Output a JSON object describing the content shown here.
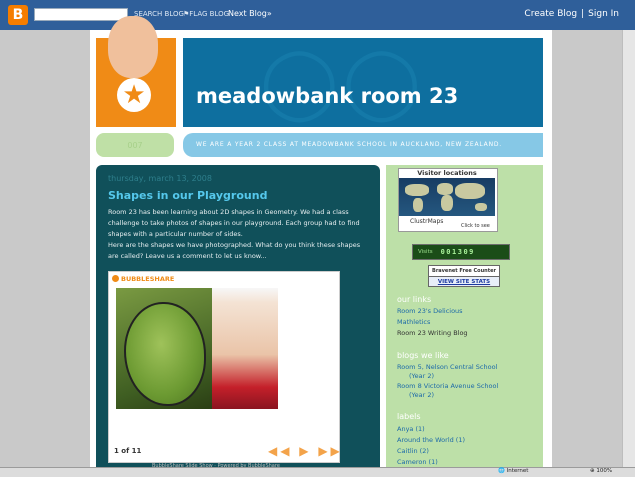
{
  "navbar": {
    "logo_letter": "B",
    "search_link": "SEARCH BLOG",
    "flag_link": "FLAG BLOG",
    "next_blog": "Next Blog»",
    "create_blog": "Create Blog",
    "separator": "|",
    "sign_in": "Sign In"
  },
  "header": {
    "title": "meadowbank room 23",
    "tagline": "WE ARE A YEAR 2 CLASS AT MEADOWBANK SCHOOL IN AUCKLAND, NEW ZEALAND.",
    "left_tab": "007",
    "star": "★"
  },
  "post": {
    "date": "thursday, march 13, 2008",
    "title": "Shapes in our Playground",
    "paragraph1": "Room 23 has been learning about 2D shapes in Geometry. We had a class challenge to take photos of shapes in our playground. Each group had to find shapes with a particular number of sides.",
    "paragraph2": "Here are the shapes we have photographed. What do you think these shapes are called? Leave us a comment to let us know..."
  },
  "bubbleshare": {
    "logo": "BUBBLESHARE",
    "counter": "1 of 11",
    "controls": "◀◀ ▶ ▶▶",
    "caption": "BubbleShare Slide Show · Powered by BubbleShare"
  },
  "sidebar": {
    "map_title": "Visitor locations",
    "map_brand": "ClustrMaps",
    "map_click": "Click to see",
    "hit_label": "Visits",
    "hit_digits": "001309",
    "bravenet": "Bravenet Free Counter",
    "view_stats": "VIEW SITE STATS",
    "our_links_heading": "our links",
    "our_links": [
      "Room 23's Delicious",
      "Mathletics",
      "Room 23 Writing Blog"
    ],
    "blogs_heading": "blogs we like",
    "blogs": [
      {
        "line1": "Room 5, Nelson Central School",
        "line2": "(Year 2)"
      },
      {
        "line1": "Room 8 Victoria Avenue School",
        "line2": "(Year 2)"
      }
    ],
    "labels_heading": "labels",
    "labels": [
      "Anya (1)",
      "Around the World (1)",
      "Caitlin (2)",
      "Cameron (1)"
    ]
  },
  "statusbar": {
    "zone": "Internet",
    "zoom": "100%"
  },
  "colors": {
    "navbar": "#2f5f9a",
    "orange": "#f08b16",
    "header_blue": "#0e6f9f",
    "post_bg": "#10505a",
    "sidebar_bg": "#bde0a8"
  }
}
